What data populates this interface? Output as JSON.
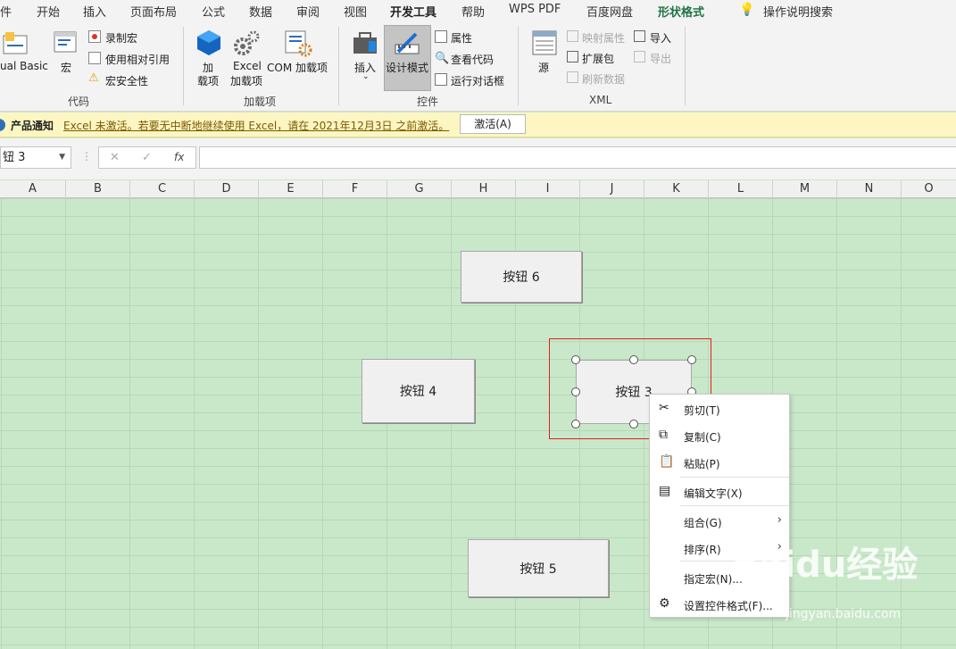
{
  "menu": [
    "件",
    "开始",
    "插入",
    "页面布局",
    "公式",
    "数据",
    "审阅",
    "视图",
    "开发工具",
    "帮助",
    "WPS PDF",
    "百度网盘",
    "形状格式",
    "操作说明搜索"
  ],
  "ribbon": {
    "code": {
      "label": "代码",
      "vb": "ual Basic",
      "macro": "宏",
      "record": "录制宏",
      "relative": "使用相对引用",
      "security": "宏安全性"
    },
    "addins": {
      "label": "加载项",
      "addin1": "加",
      "addin2": "载项",
      "excel1": "Excel",
      "excel2": "加载项",
      "com": "COM 加载项"
    },
    "controls": {
      "label": "控件",
      "insert": "插入",
      "design": "设计模式",
      "props": "属性",
      "viewcode": "查看代码",
      "dialog": "运行对话框"
    },
    "xml": {
      "label": "XML",
      "source": "源",
      "map": "映射属性",
      "expand": "扩展包",
      "refresh": "刷新数据",
      "import": "导入",
      "export": "导出"
    }
  },
  "notice": {
    "title": "产品通知",
    "message": "Excel 未激活。若要无中断地继续使用 Excel，请在 2021年12月3日 之前激活。",
    "button": "激活(A)"
  },
  "namebox": "钮 3",
  "fx": "fx",
  "columns": [
    "A",
    "B",
    "C",
    "D",
    "E",
    "F",
    "G",
    "H",
    "I",
    "J",
    "K",
    "L",
    "M",
    "N",
    "O"
  ],
  "buttons": {
    "b6": "按钮 6",
    "b4": "按钮 4",
    "b3": "按钮 3",
    "b5": "按钮 5"
  },
  "context_menu": [
    {
      "label": "剪切(T)",
      "icon": "scissors-icon"
    },
    {
      "label": "复制(C)",
      "icon": "copy-icon"
    },
    {
      "label": "粘贴(P)",
      "icon": "paste-icon"
    },
    {
      "label": "编辑文字(X)",
      "icon": "edit-text-icon"
    },
    {
      "label": "组合(G)",
      "icon": "submenu"
    },
    {
      "label": "排序(R)",
      "icon": "submenu"
    },
    {
      "label": "指定宏(N)...",
      "icon": ""
    },
    {
      "label": "设置控件格式(F)...",
      "icon": "format-control-icon"
    }
  ],
  "watermark": {
    "logo": "Baidu经验",
    "url": "jingyan.baidu.com"
  },
  "colors": {
    "accent": "#217346",
    "sheet_bg": "#c9e8c9",
    "selection": "#e02020"
  }
}
